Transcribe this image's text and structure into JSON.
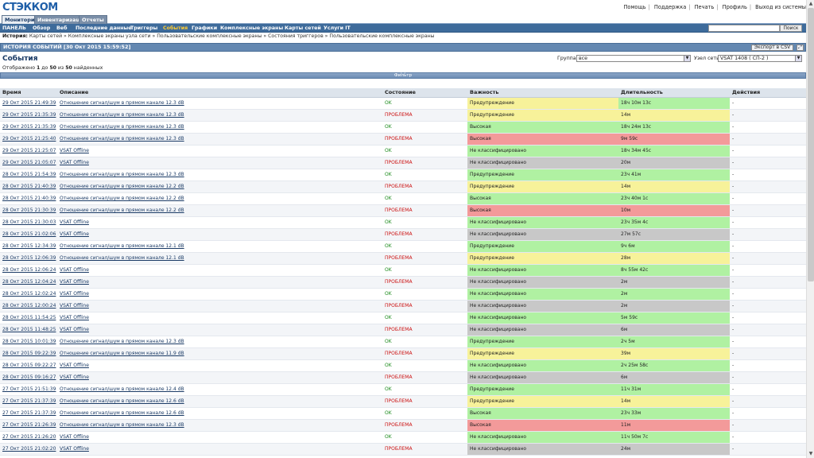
{
  "header": {
    "logo": "СТЭККОМ",
    "links": [
      "Помощь",
      "Поддержка",
      "Печать",
      "Профиль",
      "Выход из системы"
    ]
  },
  "main_tabs": [
    "Мониторинг",
    "Инвентаризация",
    "Отчеты"
  ],
  "subnav": {
    "items": [
      "ПАНЕЛЬ",
      "Обзор",
      "Веб",
      "Последние данные",
      "Триггеры",
      "События",
      "Графики",
      "Комплексные экраны",
      "Карты сетей",
      "Услуги IT"
    ],
    "active": "События",
    "search_button": "Поиск"
  },
  "history": {
    "label": "История:",
    "path": "Карты сетей » Комплексные экраны узла сети » Пользовательские комплексные экраны » Состояния триггеров » Пользовательские комплексные экраны"
  },
  "titlebar": {
    "title": "ИСТОРИЯ СОБЫТИЙ [30 Окт 2015 15:59:52]",
    "export_csv": "Экспорт в CSV"
  },
  "events": {
    "title": "События",
    "displayed_prefix": "Отображено",
    "displayed_from": "1",
    "displayed_to_word": "до",
    "displayed_to": "50",
    "displayed_of_word": "из",
    "displayed_total": "50",
    "displayed_suffix": "найденных",
    "group_label": "Группа",
    "group_value": "все",
    "node_label": "Узел сети",
    "node_value": "VSAT 1408 ( СП-2 )",
    "filter_label": "Фильтр"
  },
  "table": {
    "columns": [
      "Время",
      "Описание",
      "Состояние",
      "Важность",
      "Длительность",
      "Действия"
    ],
    "rows": [
      {
        "time": "29 Окт 2015 21:49:39",
        "desc": "Отношение сигнал/шум в прямом канале 12.3 dB",
        "state": "OK",
        "state_kind": "ok",
        "severity": "Предупреждение",
        "sev_kind": "warning",
        "duration": "18ч 10м 13с",
        "dur_kind": "ok",
        "action": "-"
      },
      {
        "time": "29 Окт 2015 21:35:39",
        "desc": "Отношение сигнал/шум в прямом канале 12.3 dB",
        "state": "ПРОБЛЕМА",
        "state_kind": "problem",
        "severity": "Предупреждение",
        "sev_kind": "warning",
        "duration": "14м",
        "dur_kind": "warning",
        "action": "-"
      },
      {
        "time": "29 Окт 2015 21:35:39",
        "desc": "Отношение сигнал/шум в прямом канале 12.3 dB",
        "state": "OK",
        "state_kind": "ok",
        "severity": "Высокая",
        "sev_kind": "ok",
        "duration": "18ч 24м 13с",
        "dur_kind": "ok",
        "action": "-"
      },
      {
        "time": "29 Окт 2015 21:25:40",
        "desc": "Отношение сигнал/шум в прямом канале 12.3 dB",
        "state": "ПРОБЛЕМА",
        "state_kind": "problem",
        "severity": "Высокая",
        "sev_kind": "high",
        "duration": "9м 59с",
        "dur_kind": "high",
        "action": "-"
      },
      {
        "time": "29 Окт 2015 21:25:07",
        "desc": "VSAT Offline",
        "state": "OK",
        "state_kind": "ok",
        "severity": "Не классифицировано",
        "sev_kind": "ok",
        "duration": "18ч 34м 45с",
        "dur_kind": "ok",
        "action": "-"
      },
      {
        "time": "29 Окт 2015 21:05:07",
        "desc": "VSAT Offline",
        "state": "ПРОБЛЕМА",
        "state_kind": "problem",
        "severity": "Не классифицировано",
        "sev_kind": "nc",
        "duration": "20м",
        "dur_kind": "nc",
        "action": "-"
      },
      {
        "time": "28 Окт 2015 21:54:39",
        "desc": "Отношение сигнал/шум в прямом канале 12.3 dB",
        "state": "OK",
        "state_kind": "ok",
        "severity": "Предупреждение",
        "sev_kind": "ok",
        "duration": "23ч 41м",
        "dur_kind": "ok",
        "action": "-"
      },
      {
        "time": "28 Окт 2015 21:40:39",
        "desc": "Отношение сигнал/шум в прямом канале 12.2 dB",
        "state": "ПРОБЛЕМА",
        "state_kind": "problem",
        "severity": "Предупреждение",
        "sev_kind": "warning",
        "duration": "14м",
        "dur_kind": "warning",
        "action": "-"
      },
      {
        "time": "28 Окт 2015 21:40:39",
        "desc": "Отношение сигнал/шум в прямом канале 12.2 dB",
        "state": "OK",
        "state_kind": "ok",
        "severity": "Высокая",
        "sev_kind": "ok",
        "duration": "23ч 40м 1с",
        "dur_kind": "ok",
        "action": "-"
      },
      {
        "time": "28 Окт 2015 21:30:39",
        "desc": "Отношение сигнал/шум в прямом канале 12.2 dB",
        "state": "ПРОБЛЕМА",
        "state_kind": "problem",
        "severity": "Высокая",
        "sev_kind": "high",
        "duration": "10м",
        "dur_kind": "high",
        "action": "-"
      },
      {
        "time": "28 Окт 2015 21:30:03",
        "desc": "VSAT Offline",
        "state": "OK",
        "state_kind": "ok",
        "severity": "Не классифицировано",
        "sev_kind": "ok",
        "duration": "23ч 35м 4с",
        "dur_kind": "ok",
        "action": "-"
      },
      {
        "time": "28 Окт 2015 21:02:06",
        "desc": "VSAT Offline",
        "state": "ПРОБЛЕМА",
        "state_kind": "problem",
        "severity": "Не классифицировано",
        "sev_kind": "nc",
        "duration": "27м 57с",
        "dur_kind": "nc",
        "action": "-"
      },
      {
        "time": "28 Окт 2015 12:34:39",
        "desc": "Отношение сигнал/шум в прямом канале 12.1 dB",
        "state": "OK",
        "state_kind": "ok",
        "severity": "Предупреждение",
        "sev_kind": "ok",
        "duration": "9ч 6м",
        "dur_kind": "ok",
        "action": "-"
      },
      {
        "time": "28 Окт 2015 12:06:39",
        "desc": "Отношение сигнал/шум в прямом канале 12.1 dB",
        "state": "ПРОБЛЕМА",
        "state_kind": "problem",
        "severity": "Предупреждение",
        "sev_kind": "warning",
        "duration": "28м",
        "dur_kind": "warning",
        "action": "-"
      },
      {
        "time": "28 Окт 2015 12:06:24",
        "desc": "VSAT Offline",
        "state": "OK",
        "state_kind": "ok",
        "severity": "Не классифицировано",
        "sev_kind": "ok",
        "duration": "8ч 55м 42с",
        "dur_kind": "ok",
        "action": "-"
      },
      {
        "time": "28 Окт 2015 12:04:24",
        "desc": "VSAT Offline",
        "state": "ПРОБЛЕМА",
        "state_kind": "problem",
        "severity": "Не классифицировано",
        "sev_kind": "nc",
        "duration": "2м",
        "dur_kind": "nc",
        "action": "-"
      },
      {
        "time": "28 Окт 2015 12:02:24",
        "desc": "VSAT Offline",
        "state": "OK",
        "state_kind": "ok",
        "severity": "Не классифицировано",
        "sev_kind": "ok",
        "duration": "2м",
        "dur_kind": "ok",
        "action": "-"
      },
      {
        "time": "28 Окт 2015 12:00:24",
        "desc": "VSAT Offline",
        "state": "ПРОБЛЕМА",
        "state_kind": "problem",
        "severity": "Не классифицировано",
        "sev_kind": "nc",
        "duration": "2м",
        "dur_kind": "nc",
        "action": "-"
      },
      {
        "time": "28 Окт 2015 11:54:25",
        "desc": "VSAT Offline",
        "state": "OK",
        "state_kind": "ok",
        "severity": "Не классифицировано",
        "sev_kind": "ok",
        "duration": "5м 59с",
        "dur_kind": "ok",
        "action": "-"
      },
      {
        "time": "28 Окт 2015 11:48:25",
        "desc": "VSAT Offline",
        "state": "ПРОБЛЕМА",
        "state_kind": "problem",
        "severity": "Не классифицировано",
        "sev_kind": "nc",
        "duration": "6м",
        "dur_kind": "nc",
        "action": "-"
      },
      {
        "time": "28 Окт 2015 10:01:39",
        "desc": "Отношение сигнал/шум в прямом канале 12.3 dB",
        "state": "OK",
        "state_kind": "ok",
        "severity": "Предупреждение",
        "sev_kind": "ok",
        "duration": "2ч 5м",
        "dur_kind": "ok",
        "action": "-"
      },
      {
        "time": "28 Окт 2015 09:22:39",
        "desc": "Отношение сигнал/шум в прямом канале 11.9 dB",
        "state": "ПРОБЛЕМА",
        "state_kind": "problem",
        "severity": "Предупреждение",
        "sev_kind": "warning",
        "duration": "39м",
        "dur_kind": "warning",
        "action": "-"
      },
      {
        "time": "28 Окт 2015 09:22:27",
        "desc": "VSAT Offline",
        "state": "OK",
        "state_kind": "ok",
        "severity": "Не классифицировано",
        "sev_kind": "ok",
        "duration": "2ч 25м 58с",
        "dur_kind": "ok",
        "action": "-"
      },
      {
        "time": "28 Окт 2015 09:16:27",
        "desc": "VSAT Offline",
        "state": "ПРОБЛЕМА",
        "state_kind": "problem",
        "severity": "Не классифицировано",
        "sev_kind": "nc",
        "duration": "6м",
        "dur_kind": "nc",
        "action": "-"
      },
      {
        "time": "27 Окт 2015 21:51:39",
        "desc": "Отношение сигнал/шум в прямом канале 12.4 dB",
        "state": "OK",
        "state_kind": "ok",
        "severity": "Предупреждение",
        "sev_kind": "ok",
        "duration": "11ч 31м",
        "dur_kind": "ok",
        "action": "-"
      },
      {
        "time": "27 Окт 2015 21:37:39",
        "desc": "Отношение сигнал/шум в прямом канале 12.6 dB",
        "state": "ПРОБЛЕМА",
        "state_kind": "problem",
        "severity": "Предупреждение",
        "sev_kind": "warning",
        "duration": "14м",
        "dur_kind": "warning",
        "action": "-"
      },
      {
        "time": "27 Окт 2015 21:37:39",
        "desc": "Отношение сигнал/шум в прямом канале 12.6 dB",
        "state": "OK",
        "state_kind": "ok",
        "severity": "Высокая",
        "sev_kind": "ok",
        "duration": "23ч 33м",
        "dur_kind": "ok",
        "action": "-"
      },
      {
        "time": "27 Окт 2015 21:26:39",
        "desc": "Отношение сигнал/шум в прямом канале 12.3 dB",
        "state": "ПРОБЛЕМА",
        "state_kind": "problem",
        "severity": "Высокая",
        "sev_kind": "high",
        "duration": "11м",
        "dur_kind": "high",
        "action": "-"
      },
      {
        "time": "27 Окт 2015 21:26:20",
        "desc": "VSAT Offline",
        "state": "OK",
        "state_kind": "ok",
        "severity": "Не классифицировано",
        "sev_kind": "ok",
        "duration": "11ч 50м 7с",
        "dur_kind": "ok",
        "action": "-"
      },
      {
        "time": "27 Окт 2015 21:02:20",
        "desc": "VSAT Offline",
        "state": "ПРОБЛЕМА",
        "state_kind": "problem",
        "severity": "Не классифицировано",
        "sev_kind": "nc",
        "duration": "24м",
        "dur_kind": "nc",
        "action": "-"
      }
    ]
  },
  "colors": {
    "ok_green": "#b0f1a2",
    "warning_yellow": "#f7f29a",
    "high_red": "#f39a9a",
    "not_classified_gray": "#c8c8c8",
    "header_blue": "#3e6b9b"
  }
}
